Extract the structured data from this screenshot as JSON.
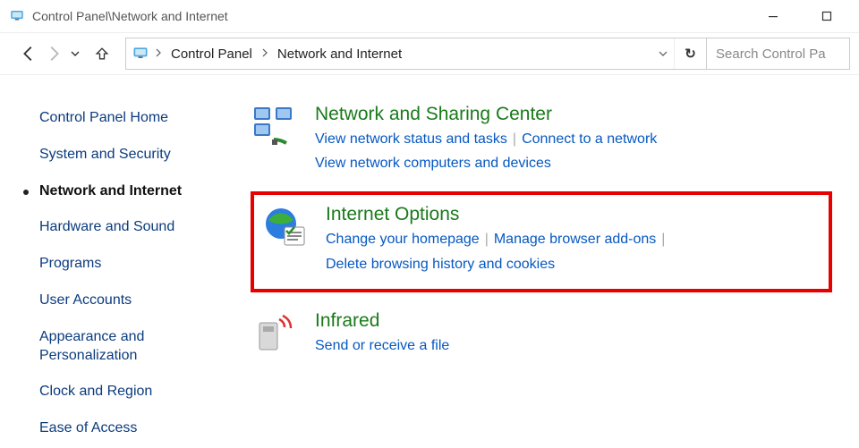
{
  "titlebar": {
    "title": "Control Panel\\Network and Internet"
  },
  "breadcrumbs": {
    "item0": "Control Panel",
    "item1": "Network and Internet"
  },
  "refresh_symbol": "↻",
  "search": {
    "placeholder": "Search Control Pa"
  },
  "sidebar": {
    "items": [
      {
        "label": "Control Panel Home"
      },
      {
        "label": "System and Security"
      },
      {
        "label": "Network and Internet"
      },
      {
        "label": "Hardware and Sound"
      },
      {
        "label": "Programs"
      },
      {
        "label": "User Accounts"
      },
      {
        "label": "Appearance and Personalization"
      },
      {
        "label": "Clock and Region"
      },
      {
        "label": "Ease of Access"
      }
    ]
  },
  "categories": {
    "network_sharing": {
      "title": "Network and Sharing Center",
      "links": [
        "View network status and tasks",
        "Connect to a network",
        "View network computers and devices"
      ]
    },
    "internet_options": {
      "title": "Internet Options",
      "links": [
        "Change your homepage",
        "Manage browser add-ons",
        "Delete browsing history and cookies"
      ]
    },
    "infrared": {
      "title": "Infrared",
      "links": [
        "Send or receive a file"
      ]
    }
  }
}
